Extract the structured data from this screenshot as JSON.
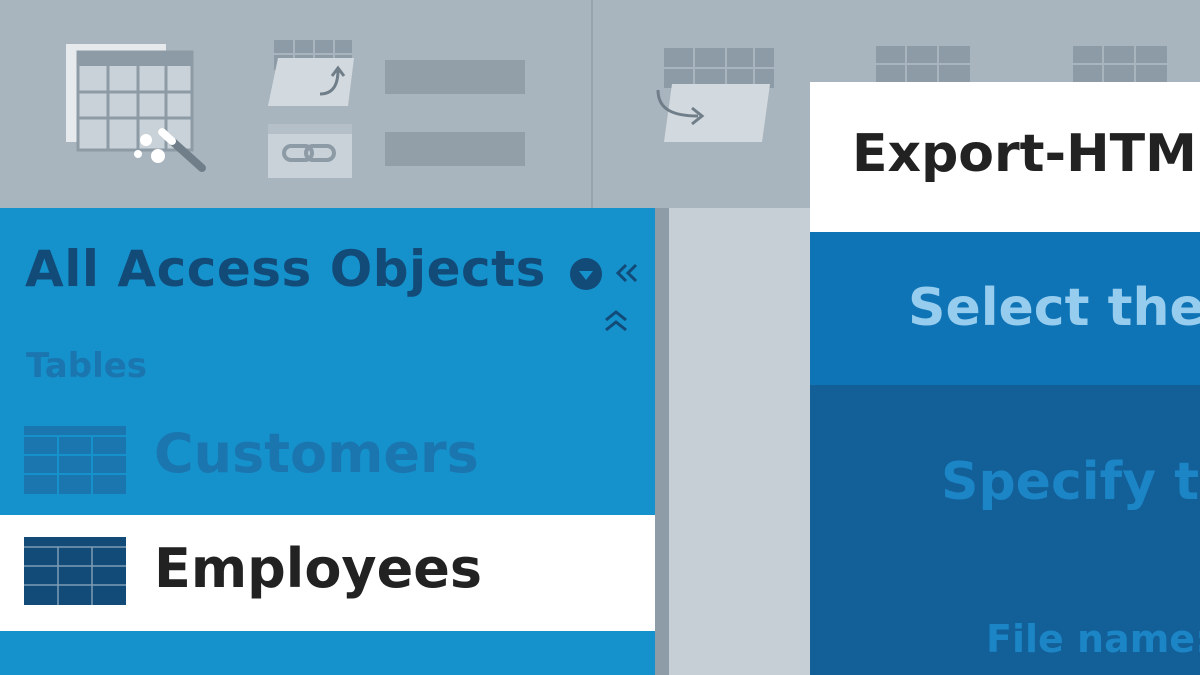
{
  "ribbon": {
    "groups": [
      {
        "icon": "table-wizard-icon"
      },
      {
        "icon": "import-table-icon"
      },
      {
        "icon": "linked-table-icon"
      },
      {
        "icon": "export-table-icon"
      }
    ]
  },
  "navigation_pane": {
    "title": "All Access Objects",
    "group_label": "Tables",
    "items": [
      {
        "label": "Customers",
        "icon": "table-icon",
        "selected": false
      },
      {
        "label": "Employees",
        "icon": "table-icon",
        "selected": true
      }
    ],
    "controls": [
      "menu-dropdown-icon",
      "collapse-pane-icon",
      "collapse-group-icon"
    ]
  },
  "export_dialog": {
    "title": "Export-HTML",
    "step1": "Select the d",
    "step2": "Specify th",
    "file_name_label": "File name:"
  },
  "colors": {
    "ribbon": "#a9b5be",
    "nav_pane": "#1591cc",
    "nav_text": "#124a78",
    "selected_row": "#ffffff",
    "dialog_step": "#0f74b6",
    "dialog_body": "#135f98"
  }
}
